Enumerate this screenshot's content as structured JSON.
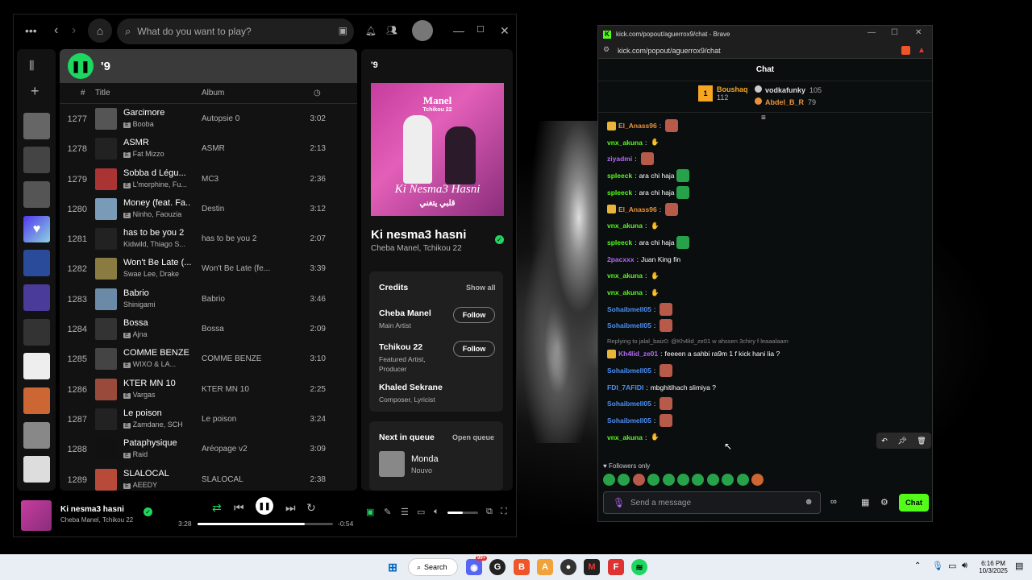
{
  "spotify": {
    "search_placeholder": "What do you want to play?",
    "playlist_title": "'9",
    "col_num": "#",
    "col_title": "Title",
    "col_album": "Album",
    "tracks": [
      {
        "num": "1277",
        "title": "Garcimore",
        "artist": "Booba",
        "album": "Autopsie 0",
        "dur": "3:02",
        "explicit": true,
        "color": "#555"
      },
      {
        "num": "1278",
        "title": "ASMR",
        "artist": "Fat Mizzo",
        "album": "ASMR",
        "dur": "2:13",
        "explicit": true,
        "color": "#222"
      },
      {
        "num": "1279",
        "title": "Sobba d Légu...",
        "artist": "L'morphine, Fu...",
        "album": "MC3",
        "dur": "2:36",
        "explicit": true,
        "color": "#a33"
      },
      {
        "num": "1280",
        "title": "Money (feat. Fa...",
        "artist": "Ninho, Faouzia",
        "album": "Destin",
        "dur": "3:12",
        "explicit": true,
        "color": "#7a9bb8"
      },
      {
        "num": "1281",
        "title": "has to be you 2",
        "artist": "Kidwild, Thiago S...",
        "album": "has to be you 2",
        "dur": "2:07",
        "explicit": false,
        "color": "#222"
      },
      {
        "num": "1282",
        "title": "Won't Be Late (...",
        "artist": "Swae Lee, Drake",
        "album": "Won't Be Late (fe...",
        "dur": "3:39",
        "explicit": false,
        "color": "#8a7b40"
      },
      {
        "num": "1283",
        "title": "Babrio",
        "artist": "Shinigami",
        "album": "Babrio",
        "dur": "3:46",
        "explicit": false,
        "color": "#6a8aa8"
      },
      {
        "num": "1284",
        "title": "Bossa",
        "artist": "Ajna",
        "album": "Bossa",
        "dur": "2:09",
        "explicit": true,
        "color": "#333"
      },
      {
        "num": "1285",
        "title": "COMME BENZE",
        "artist": "WIXO & LA...",
        "album": "COMME BENZE",
        "dur": "3:10",
        "explicit": true,
        "color": "#444"
      },
      {
        "num": "1286",
        "title": "KTER MN 10",
        "artist": "Vargas",
        "album": "KTER MN 10",
        "dur": "2:25",
        "explicit": true,
        "color": "#9a4a3a"
      },
      {
        "num": "1287",
        "title": "Le poison",
        "artist": "Zamdane, SCH",
        "album": "Le poison",
        "dur": "3:24",
        "explicit": true,
        "color": "#222"
      },
      {
        "num": "1288",
        "title": "Pataphysique",
        "artist": "Raid",
        "album": "Aréopage v2",
        "dur": "3:09",
        "explicit": true,
        "color": "#111"
      },
      {
        "num": "1289",
        "title": "SLALOCAL",
        "artist": "AEEDY",
        "album": "SLALOCAL",
        "dur": "2:38",
        "explicit": true,
        "color": "#b84a3a"
      }
    ],
    "np_panel_title": "'9",
    "cover_line1": "Manel",
    "cover_line2": "Tchikou 22",
    "cover_script": "Ki Nesma3 Hasni",
    "cover_arabic": "قلبي يتغني",
    "song": "Ki nesma3 hasni",
    "song_artists": "Cheba Manel, Tchikou 22",
    "credits_title": "Credits",
    "show_all": "Show all",
    "credits": [
      {
        "name": "Cheba Manel",
        "role": "Main Artist",
        "follow": "Follow"
      },
      {
        "name": "Tchikou 22",
        "role": "Featured Artist, Producer",
        "follow": "Follow"
      },
      {
        "name": "Khaled Sekrane",
        "role": "Composer, Lyricist",
        "follow": ""
      }
    ],
    "queue_title": "Next in queue",
    "open_queue": "Open queue",
    "queue_song": "Monda",
    "queue_artist": "Nouvo",
    "player": {
      "song": "Ki nesma3 hasni",
      "artists": "Cheba Manel, Tchikou 22",
      "elapsed": "3:28",
      "remaining": "-0:54",
      "progress": 0.79,
      "volume": 0.5
    }
  },
  "brave": {
    "title": "kick.com/popout/aguerrox9/chat - Brave",
    "url": "kick.com/popout/aguerrox9/chat",
    "chat_title": "Chat",
    "top": [
      {
        "rank": "1",
        "name": "Boushaq",
        "score": "112",
        "color": "#f5a623"
      },
      {
        "name": "vodkafunky",
        "score": "105",
        "color": "#ccc"
      },
      {
        "name": "Abdel_B_R",
        "score": "79",
        "color": "#e8923a"
      }
    ],
    "messages": [
      {
        "user": "El_Anass96",
        "color": "#e8923a",
        "text": "",
        "emote": true,
        "badge": true
      },
      {
        "user": "vnx_akuna",
        "color": "#53fc18",
        "text": "",
        "emote": false,
        "badge": false
      },
      {
        "user": "ziyadmi",
        "color": "#b567f5",
        "text": "",
        "emote": true,
        "badge": false
      },
      {
        "user": "spleeck",
        "color": "#53fc18",
        "text": "ara chi haja",
        "emote": true,
        "badge": false
      },
      {
        "user": "spleeck",
        "color": "#53fc18",
        "text": "ara chi haja",
        "emote": true,
        "badge": false
      },
      {
        "user": "El_Anass96",
        "color": "#e8923a",
        "text": "",
        "emote": true,
        "badge": true
      },
      {
        "user": "vnx_akuna",
        "color": "#53fc18",
        "text": "",
        "emote": false,
        "badge": false
      },
      {
        "user": "spleeck",
        "color": "#53fc18",
        "text": "ara chi haja",
        "emote": true,
        "badge": false
      },
      {
        "user": "2pacxxx",
        "color": "#b567f5",
        "text": "Juan King fin",
        "emote": false,
        "badge": false
      },
      {
        "user": "vnx_akuna",
        "color": "#53fc18",
        "text": "",
        "emote": false,
        "badge": false
      },
      {
        "user": "vnx_akuna",
        "color": "#53fc18",
        "text": "",
        "emote": false,
        "badge": false
      },
      {
        "user": "Sohaibmell05",
        "color": "#4a8ff5",
        "text": "",
        "emote": true,
        "badge": false
      },
      {
        "user": "Sohaibmell05",
        "color": "#4a8ff5",
        "text": "",
        "emote": true,
        "badge": false
      }
    ],
    "reply_note": "Replying to jalal_baiz0: @Kh4lid_ze01 w ahssen 3chiry f leaaalaam",
    "messages2": [
      {
        "user": "Kh4lid_ze01",
        "color": "#b567f5",
        "text": "feeeen a sahbi ra9m 1 f kick hani lia ?",
        "emote": false,
        "badge": true
      },
      {
        "user": "Sohaibmell05",
        "color": "#4a8ff5",
        "text": "",
        "emote": true,
        "badge": false
      },
      {
        "user": "FDI_7AFIDI",
        "color": "#4a8ff5",
        "text": "mbghitihach slimiya ?",
        "emote": false,
        "badge": false
      },
      {
        "user": "Sohaibmell05",
        "color": "#4a8ff5",
        "text": "",
        "emote": true,
        "badge": false
      },
      {
        "user": "Sohaibmell05",
        "color": "#4a8ff5",
        "text": "",
        "emote": true,
        "badge": false
      },
      {
        "user": "vnx_akuna",
        "color": "#53fc18",
        "text": "",
        "emote": false,
        "badge": false
      }
    ],
    "followers_only": "Followers only",
    "send_placeholder": "Send a message",
    "chat_button": "Chat"
  },
  "taskbar": {
    "search": "Search",
    "time": "6:16 PM",
    "date": "10/3/2025",
    "badge": "99+"
  }
}
